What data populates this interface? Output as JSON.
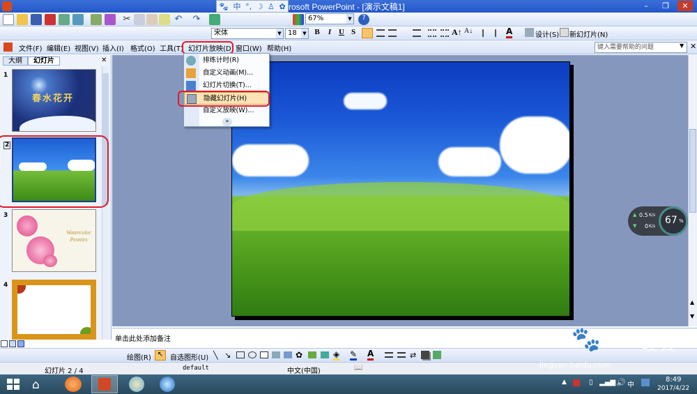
{
  "title_bar": {
    "title": "rosoft PowerPoint - [演示文稿1]"
  },
  "ime": {
    "lang": "中"
  },
  "standard_toolbar": {
    "zoom": "67%"
  },
  "formatting_toolbar": {
    "font": "宋体",
    "size": "18",
    "bold": "B",
    "italic": "I",
    "underline": "U",
    "shadow": "S",
    "design": "设计(S)",
    "new_slide": "新幻灯片(N)"
  },
  "menubar": {
    "items": [
      "文件(F)",
      "编辑(E)",
      "视图(V)",
      "插入(I)",
      "格式(O)",
      "工具(T)",
      "幻灯片放映(D)",
      "窗口(W)",
      "帮助(H)"
    ],
    "help_placeholder": "键入需要帮助的问题"
  },
  "dropdown": {
    "items": [
      "排练计时(R)",
      "自定义动画(M)...",
      "幻灯片切换(T)...",
      "隐藏幻灯片(H)",
      "自定义放映(W)..."
    ]
  },
  "left_pane": {
    "tabs": [
      "大纲",
      "幻灯片"
    ],
    "slides": [
      {
        "num": "1",
        "title": "春水花开"
      },
      {
        "num": "2"
      },
      {
        "num": "3",
        "caption": "Watercolor Peonies"
      },
      {
        "num": "4"
      }
    ]
  },
  "notes": {
    "placeholder": "单击此处添加备注"
  },
  "draw_toolbar": {
    "draw": "绘图(R)",
    "autoshapes": "自选图形(U)"
  },
  "status": {
    "slide": "幻灯片 2 / 4",
    "design": "default",
    "language": "中文(中国)"
  },
  "net_widget": {
    "up": "0.5",
    "up_unit": "K/s",
    "down": "0",
    "down_unit": "K/s",
    "cpu": "67",
    "cpu_unit": "%"
  },
  "watermark": {
    "brand_cn": "经验",
    "url": "jingyan.baidu.com"
  },
  "taskbar": {
    "time": "8:49",
    "date": "2017/4/22",
    "ime": "中"
  },
  "colors": {
    "highlight": "#e0192a",
    "titlebar": "#2b5fcf",
    "taskbar": "#2f5266"
  }
}
